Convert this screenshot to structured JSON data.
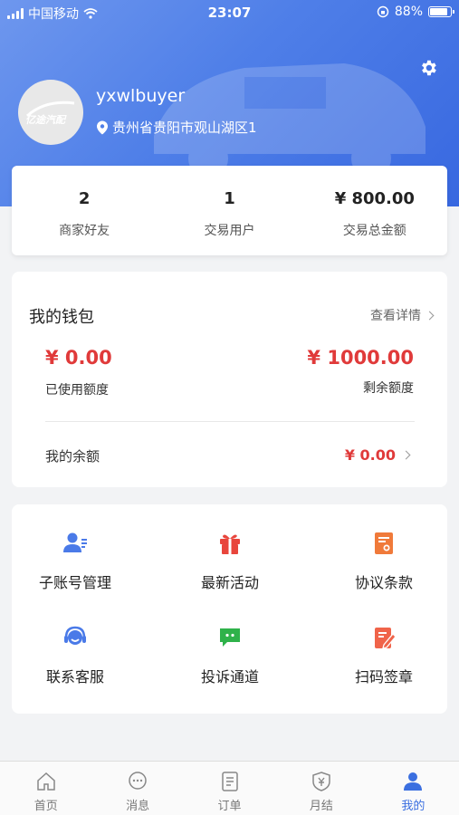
{
  "status_bar": {
    "carrier": "中国移动",
    "time": "23:07",
    "battery": "88%"
  },
  "profile": {
    "username": "yxwlbuyer",
    "location": "贵州省贵阳市观山湖区1",
    "logo_text": "亿途汽配"
  },
  "stats": [
    {
      "value": "2",
      "label": "商家好友"
    },
    {
      "value": "1",
      "label": "交易用户"
    },
    {
      "value": "¥ 800.00",
      "label": "交易总金额"
    }
  ],
  "wallet": {
    "title": "我的钱包",
    "detail_link": "查看详情",
    "used_amount": "¥ 0.00",
    "used_label": "已使用额度",
    "remaining_amount": "¥ 1000.00",
    "remaining_label": "剩余额度",
    "balance_label": "我的余额",
    "balance_value": "¥ 0.00"
  },
  "services": [
    {
      "label": "子账号管理",
      "icon": "sub-account-icon"
    },
    {
      "label": "最新活动",
      "icon": "gift-icon"
    },
    {
      "label": "协议条款",
      "icon": "agreement-icon"
    },
    {
      "label": "联系客服",
      "icon": "headset-icon"
    },
    {
      "label": "投诉通道",
      "icon": "chat-bubble-icon"
    },
    {
      "label": "扫码签章",
      "icon": "sign-pen-icon"
    }
  ],
  "tabbar": [
    {
      "label": "首页",
      "icon": "home-icon"
    },
    {
      "label": "消息",
      "icon": "message-icon"
    },
    {
      "label": "订单",
      "icon": "order-icon"
    },
    {
      "label": "月结",
      "icon": "monthly-settlement-icon"
    },
    {
      "label": "我的",
      "icon": "profile-icon",
      "active": true
    }
  ],
  "colors": {
    "accent": "#3b6fe0",
    "price": "#e03a3a",
    "service_blue": "#4a7ae8",
    "service_red": "#e8453c",
    "service_orange": "#f07a3a",
    "service_green": "#2fb24a"
  }
}
